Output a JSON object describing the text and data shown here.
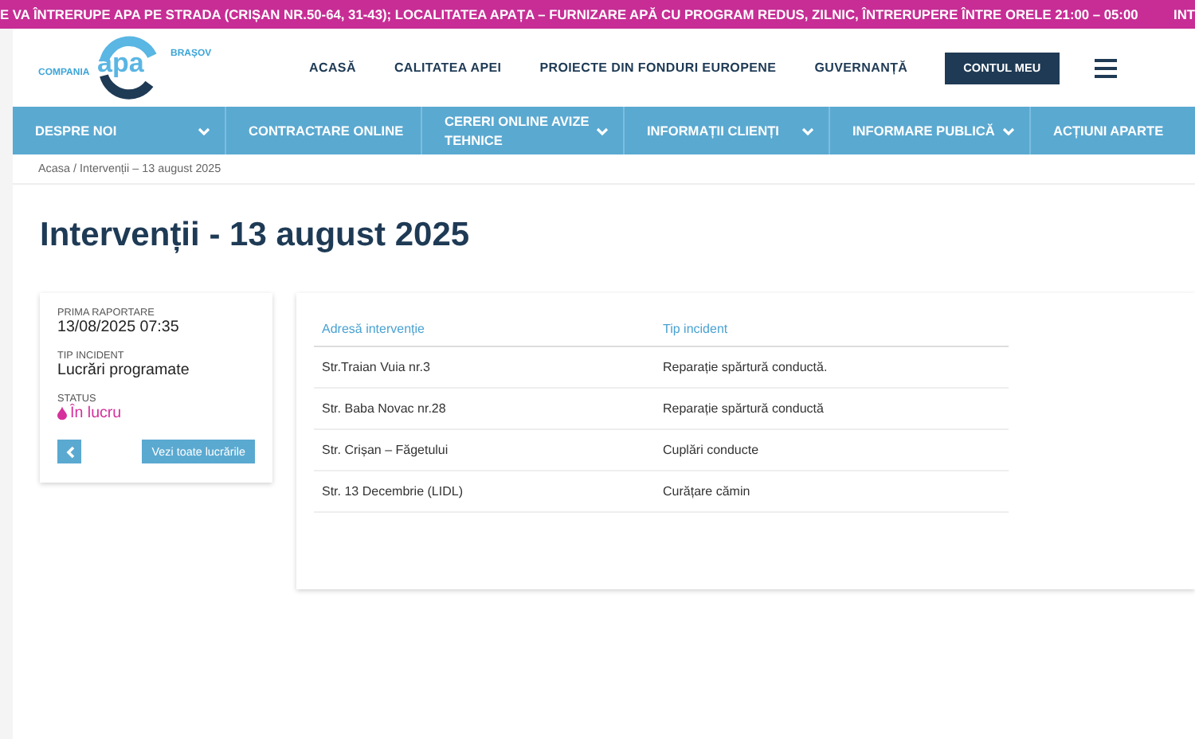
{
  "ticker": {
    "text": "E VA ÎNTRERUPE APA PE STRADA (CRIȘAN NR.50-64, 31-43); LOCALITATEA APAȚA – FURNIZARE APĂ CU PROGRAM REDUS, ZILNIC, ÎNTRERUPERE ÎNTRE ORELE 21:00 – 05:00",
    "next": "INT"
  },
  "logo": {
    "left": "COMPANIA",
    "center": "apa",
    "right": "BRAȘOV"
  },
  "top_menu": [
    "ACASĂ",
    "CALITATEA APEI",
    "PROIECTE DIN FONDURI EUROPENE",
    "GUVERNANȚĂ"
  ],
  "account_button": "CONTUL MEU",
  "nav": [
    {
      "label": "DESPRE NOI",
      "dropdown": true
    },
    {
      "label": "CONTRACTARE ONLINE",
      "dropdown": false
    },
    {
      "label": "CERERI ONLINE AVIZE TEHNICE",
      "dropdown": true
    },
    {
      "label": "INFORMAȚII CLIENȚI",
      "dropdown": true
    },
    {
      "label": "INFORMARE PUBLICĂ",
      "dropdown": true
    },
    {
      "label": "ACȚIUNI APARTE",
      "dropdown": false
    }
  ],
  "breadcrumb": "Acasa / Intervenții – 13 august 2025",
  "title": "Intervenții - 13 august 2025",
  "details": [
    {
      "label": "PRIMA RAPORTARE",
      "value": "13/08/2025 07:35",
      "kind": "text"
    },
    {
      "label": "TIP INCIDENT",
      "value": "Lucrări programate",
      "kind": "text"
    },
    {
      "label": "STATUS",
      "value": "În lucru",
      "kind": "status",
      "color": "#d6309c"
    }
  ],
  "all_works_button": "Vezi toate lucrările",
  "table": {
    "columns": [
      "Adresă intervenție",
      "Tip incident"
    ],
    "rows": [
      [
        "Str.Traian Vuia nr.3",
        "Reparație spărtură conductă."
      ],
      [
        "Str. Baba Novac nr.28",
        "Reparație spărtură conductă"
      ],
      [
        "Str. Crișan – Făgetului",
        "Cuplări conducte"
      ],
      [
        "Str. 13 Decembrie (LIDL)",
        "Curățare cămin"
      ]
    ]
  }
}
